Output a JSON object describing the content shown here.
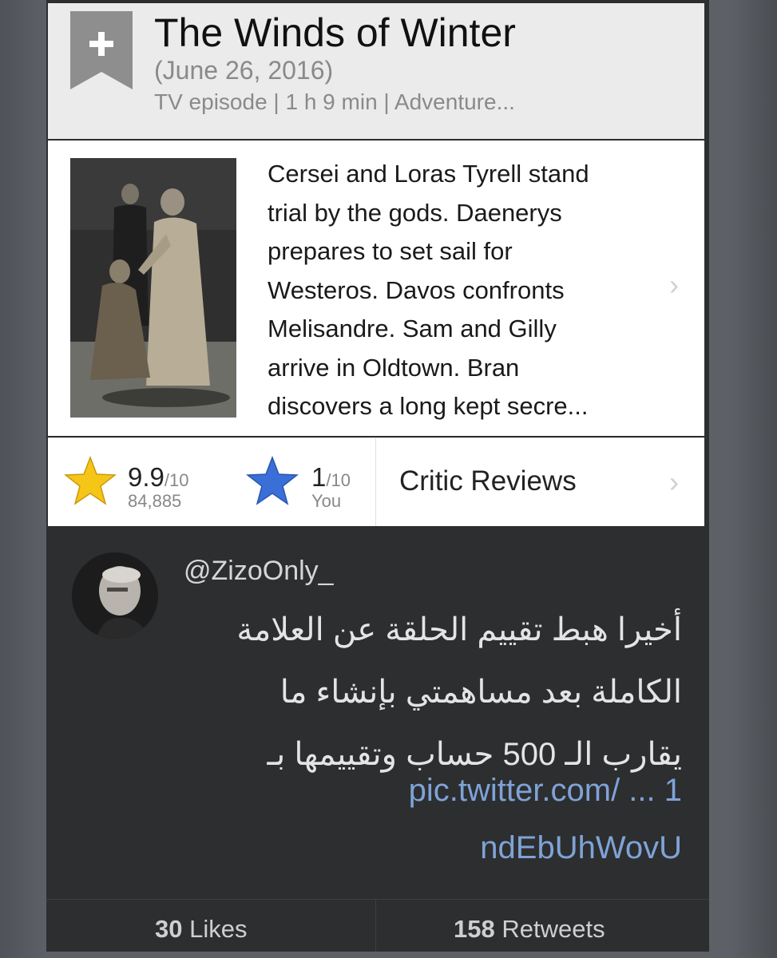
{
  "episode": {
    "title": "The Winds of Winter",
    "date": "(June 26, 2016)",
    "meta": "TV episode | 1 h 9 min | Adventure...",
    "plot_lines": [
      "Cersei and Loras Tyrell stand",
      "trial by the gods. Daenerys",
      "prepares to set sail for",
      "Westeros. Davos confronts",
      "Melisandre. Sam and Gilly",
      "arrive in Oldtown. Bran",
      "discovers a long kept secre..."
    ]
  },
  "ratings": {
    "imdb_score": "9.9",
    "imdb_denominator": "/10",
    "imdb_count": "84,885",
    "user_score": "1",
    "user_denominator": "/10",
    "user_label": "You",
    "critic_reviews": "Critic Reviews"
  },
  "tweet": {
    "handle": "@ZizoOnly_",
    "text_lines": [
      "أخيرا هبط تقييم الحلقة عن العلامة",
      "الكاملة بعد مساهمتي بإنشاء ما",
      "يقارب الـ 500 حساب وتقييمها بـ"
    ],
    "link_line1": "pic.twitter.com/ ... 1",
    "link_line2": "ndEbUhWovU",
    "likes_count": "30",
    "likes_label": " Likes",
    "retweets_count": "158",
    "retweets_label": " Retweets"
  },
  "colors": {
    "imdb_star": "#f5c518",
    "user_star": "#3b6fd8",
    "link": "#7fa3d6",
    "tweet_bg": "#2d2e30"
  },
  "icons": {
    "bookmark": "bookmark-plus-icon",
    "chevron": "chevron-right-icon",
    "rating_star": "star-icon"
  }
}
